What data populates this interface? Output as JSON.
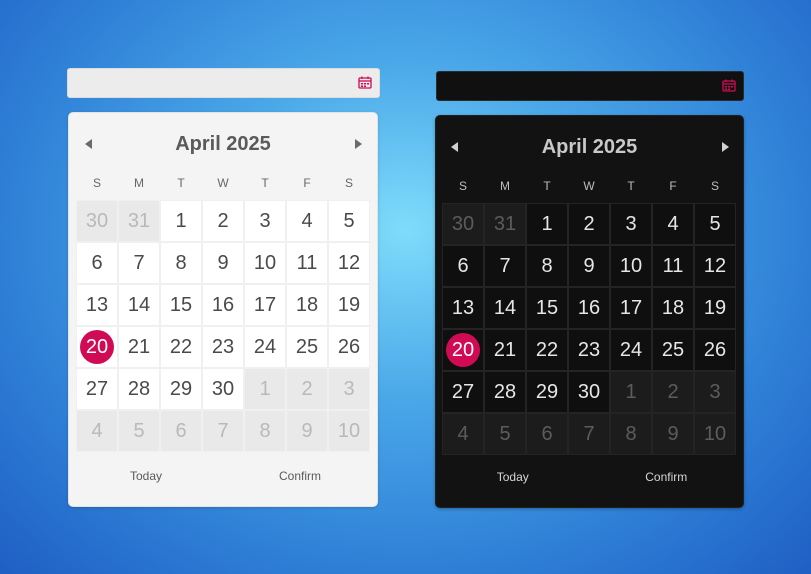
{
  "accent_color": "#d10a55",
  "light": {
    "input_value": "",
    "calendar_icon": "calendar-icon",
    "month_title": "April 2025",
    "prev_icon": "caret-left-icon",
    "next_icon": "caret-right-icon",
    "weekdays": [
      "S",
      "M",
      "T",
      "W",
      "T",
      "F",
      "S"
    ],
    "days": [
      "30",
      "31",
      "1",
      "2",
      "3",
      "4",
      "5",
      "6",
      "7",
      "8",
      "9",
      "10",
      "11",
      "12",
      "13",
      "14",
      "15",
      "16",
      "17",
      "18",
      "19",
      "20",
      "21",
      "22",
      "23",
      "24",
      "25",
      "26",
      "27",
      "28",
      "29",
      "30",
      "1",
      "2",
      "3",
      "4",
      "5",
      "6",
      "7",
      "8",
      "9",
      "10"
    ],
    "selected_day": "20",
    "today_label": "Today",
    "confirm_label": "Confirm"
  },
  "dark": {
    "input_value": "",
    "calendar_icon": "calendar-icon",
    "month_title": "April 2025",
    "prev_icon": "caret-left-icon",
    "next_icon": "caret-right-icon",
    "weekdays": [
      "S",
      "M",
      "T",
      "W",
      "T",
      "F",
      "S"
    ],
    "days": [
      "30",
      "31",
      "1",
      "2",
      "3",
      "4",
      "5",
      "6",
      "7",
      "8",
      "9",
      "10",
      "11",
      "12",
      "13",
      "14",
      "15",
      "16",
      "17",
      "18",
      "19",
      "20",
      "21",
      "22",
      "23",
      "24",
      "25",
      "26",
      "27",
      "28",
      "29",
      "30",
      "1",
      "2",
      "3",
      "4",
      "5",
      "6",
      "7",
      "8",
      "9",
      "10"
    ],
    "selected_day": "20",
    "today_label": "Today",
    "confirm_label": "Confirm"
  }
}
